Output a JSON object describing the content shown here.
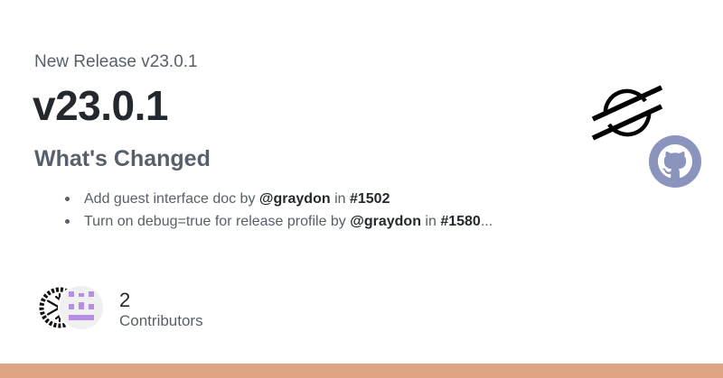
{
  "release": {
    "subtitle": "New Release v23.0.1",
    "title": "v23.0.1"
  },
  "changes": {
    "heading": "What's Changed",
    "items": [
      {
        "text_before": "Add guest interface doc by ",
        "user": "@graydon",
        "text_mid": " in ",
        "pr": "#1502",
        "suffix": ""
      },
      {
        "text_before": "Turn on debug=true for release profile by ",
        "user": "@graydon",
        "text_mid": " in ",
        "pr": "#1580",
        "suffix": "..."
      }
    ]
  },
  "contributors": {
    "count": "2",
    "label": "Contributors"
  },
  "icons": {
    "stellar_logo": "stellar-logo-icon",
    "github_logo": "github-logo-icon"
  },
  "colors": {
    "footer_bar": "#dea584",
    "github_badge": "#8a94bd",
    "avatar_pixel": "#b58ee6"
  }
}
